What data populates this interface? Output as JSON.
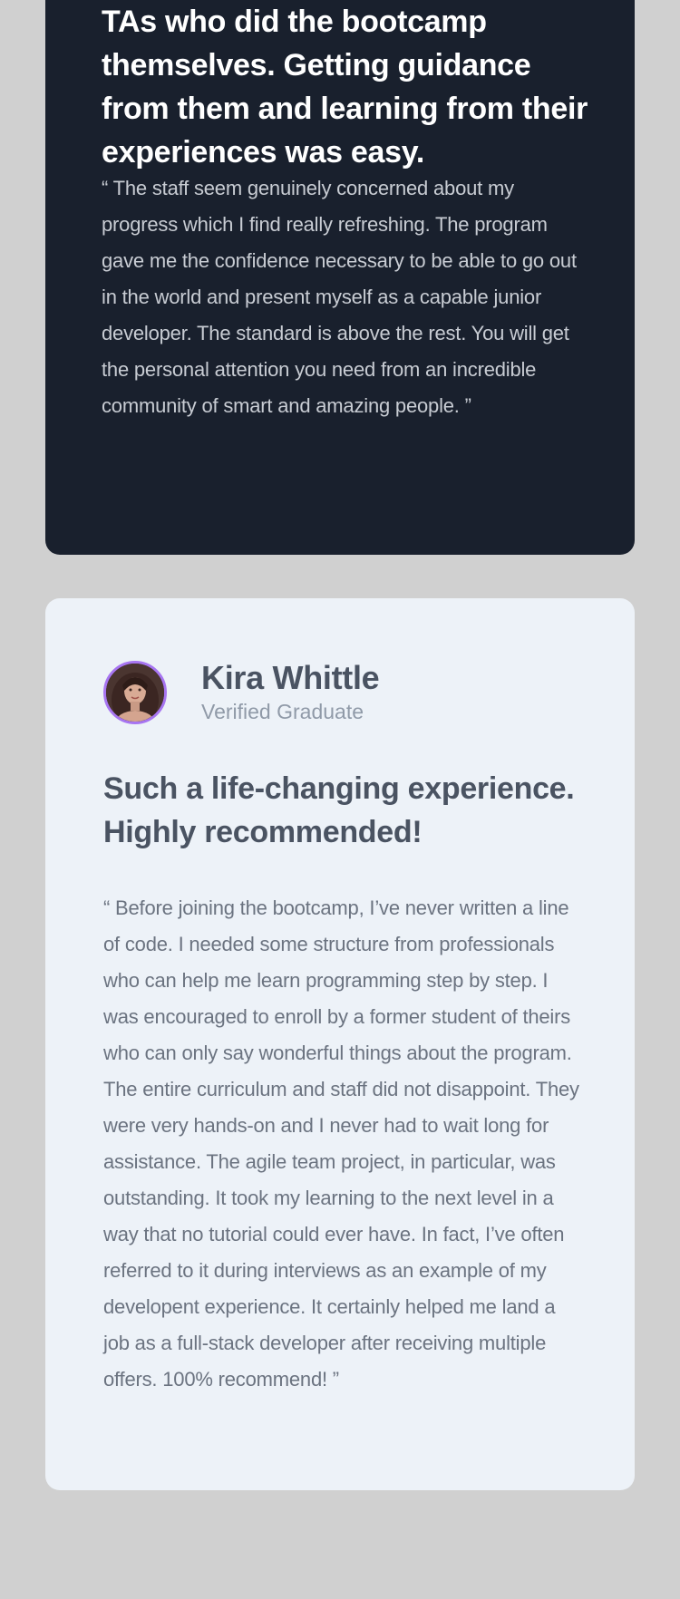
{
  "testimonials": [
    {
      "headline": "TAs who did the bootcamp themselves. Getting guidance from them and learning from their experiences was easy.",
      "quote": "“ The staff seem genuinely concerned about my progress which I find really refreshing. The program gave me the confidence necessary to be able to go out in the world and present myself as a capable junior developer. The standard is above the rest. You will get the personal attention you need from an incredible community of smart and amazing people. ”"
    },
    {
      "name": "Kira Whittle",
      "status": "Verified Graduate",
      "headline": "Such a life-changing experience. Highly recommended!",
      "quote": "“ Before joining the bootcamp, I’ve never written a line of code. I needed some structure from professionals who can help me learn programming step by step. I was encouraged to enroll by a former student of theirs who can only say wonderful things about the program. The entire curriculum and staff did not disappoint. They were very hands-on and I never had to wait long for assistance. The agile team project, in particular, was outstanding. It took my learning to the next level in a way that no tutorial could ever have. In fact, I’ve often referred to it during interviews as an example of my developent experience. It certainly helped me land a job as a full-stack developer after receiving multiple offers. 100% recommend! ”"
    }
  ],
  "colors": {
    "page_background": "#d0d0d0",
    "dark_card": "#19202d",
    "light_card": "#edf2f8",
    "avatar_border": "#a775f1"
  }
}
